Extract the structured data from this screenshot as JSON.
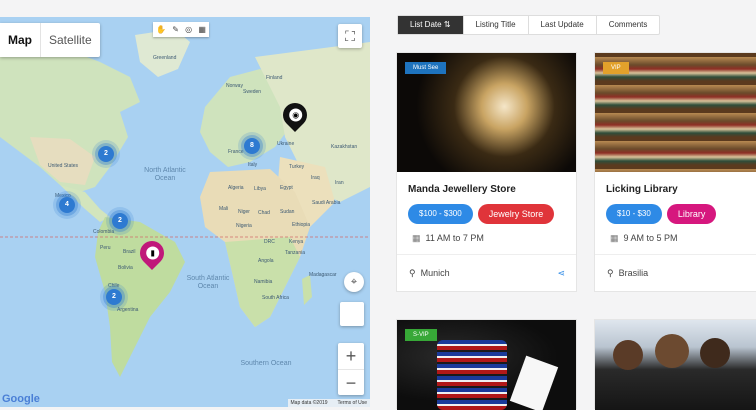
{
  "map": {
    "type_buttons": {
      "map": "Map",
      "satellite": "Satellite"
    },
    "labels": {
      "greenland": "Greenland",
      "united_states": "United States",
      "mexico": "Mexico",
      "colombia": "Colombia",
      "brazil": "Brazil",
      "bolivia": "Bolivia",
      "chile": "Chile",
      "argentina": "Argentina",
      "france": "France",
      "italy": "Italy",
      "ukraine": "Ukraine",
      "kazakhstan": "Kazakhstan",
      "turkey": "Turkey",
      "iraq": "Iraq",
      "iran": "Iran",
      "algeria": "Algeria",
      "libya": "Libya",
      "egypt": "Egypt",
      "mali": "Mali",
      "niger": "Niger",
      "chad": "Chad",
      "sudan": "Sudan",
      "nigeria": "Nigeria",
      "ethiopia": "Ethiopia",
      "kenya": "Kenya",
      "drc": "DRC",
      "tanzania": "Tanzania",
      "angola": "Angola",
      "namibia": "Namibia",
      "south_africa": "South Africa",
      "madagascar": "Madagascar",
      "peru": "Peru",
      "saudi_arabia": "Saudi Arabia",
      "norway": "Norway",
      "sweden": "Sweden",
      "finland": "Finland"
    },
    "oceans": {
      "north_atlantic": "North Atlantic Ocean",
      "south_atlantic": "South Atlantic Ocean",
      "southern": "Southern Ocean"
    },
    "clusters": [
      "2",
      "4",
      "2",
      "2",
      "8"
    ],
    "google": "Google",
    "map_data": "Map data ©2019",
    "terms": "Terms of Use"
  },
  "sort_tabs": [
    "List Date",
    "Listing Title",
    "Last Update",
    "Comments"
  ],
  "listings": [
    {
      "badge": "Must See",
      "badge_color": "#1e73be",
      "title": "Manda Jewellery Store",
      "price": "$100 - $300",
      "category": "Jewelry Store",
      "category_color": "#e0343a",
      "hours": "11 AM to 7 PM",
      "location": "Munich"
    },
    {
      "badge": "VIP",
      "badge_color": "#e2a12b",
      "title": "Licking Library",
      "price": "$10 - $30",
      "category": "Library",
      "category_color": "#d6177e",
      "hours": "9 AM to 5 PM",
      "location": "Brasilia"
    },
    {
      "badge": "S-VIP",
      "badge_color": "#37a837"
    },
    {
      "badge": ""
    }
  ],
  "colors": {
    "price_chip": "#2e8ae6",
    "accent": "#333333",
    "pin_magenta": "#c0187a",
    "pin_black": "#111111"
  }
}
